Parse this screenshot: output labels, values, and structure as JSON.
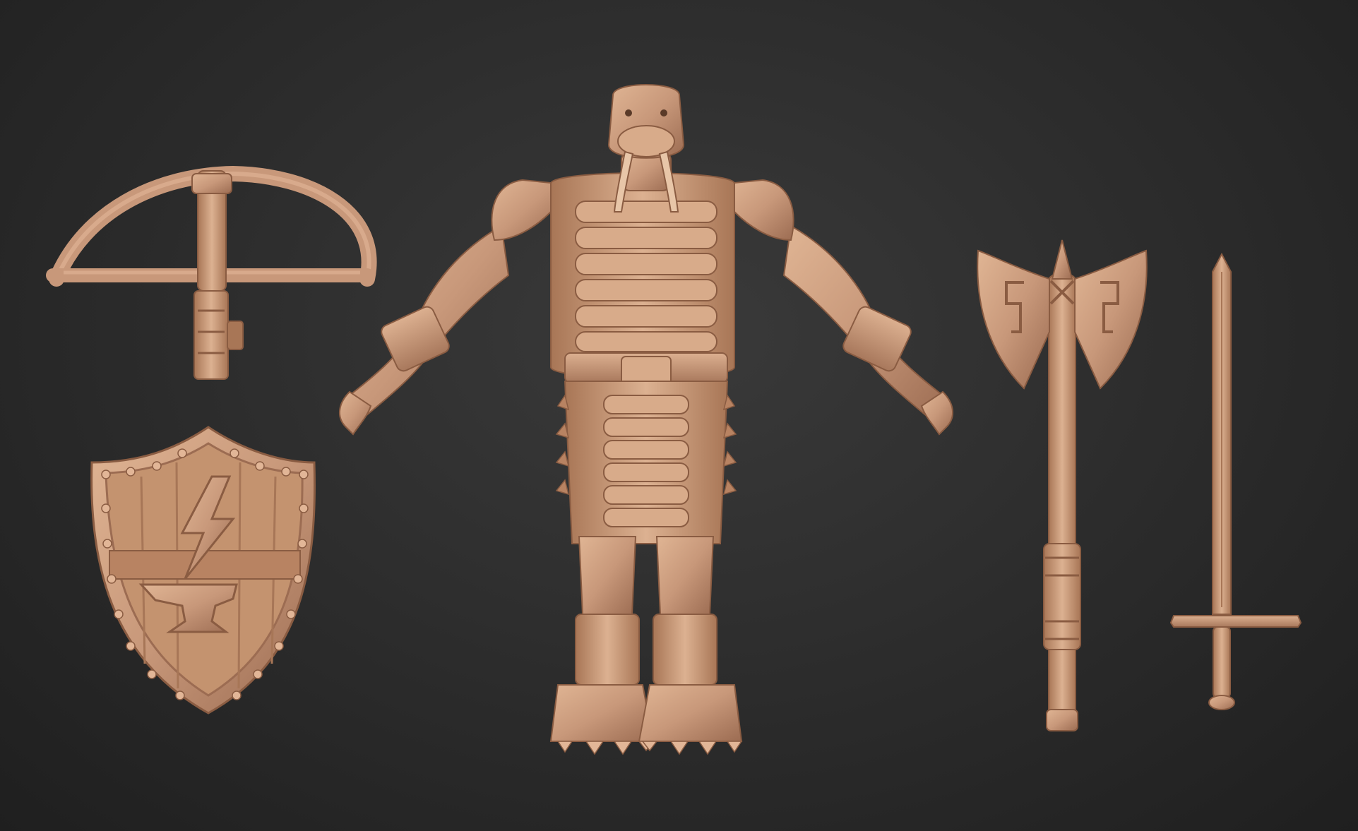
{
  "scene": {
    "background_color": "#2e2e2e",
    "clay_color": "#c8987a",
    "clay_highlight": "#e2b697",
    "clay_shadow": "#8f6248"
  },
  "objects": [
    {
      "name": "crossbow",
      "icon": "crossbow-icon"
    },
    {
      "name": "heater-shield",
      "icon": "shield-icon",
      "emblem": [
        "lightning-bolt-icon",
        "anvil-icon"
      ]
    },
    {
      "name": "walrus-warrior-figure",
      "icon": "walrus-warrior-icon"
    },
    {
      "name": "double-bladed-axe",
      "icon": "double-axe-icon"
    },
    {
      "name": "longsword",
      "icon": "sword-icon"
    }
  ]
}
